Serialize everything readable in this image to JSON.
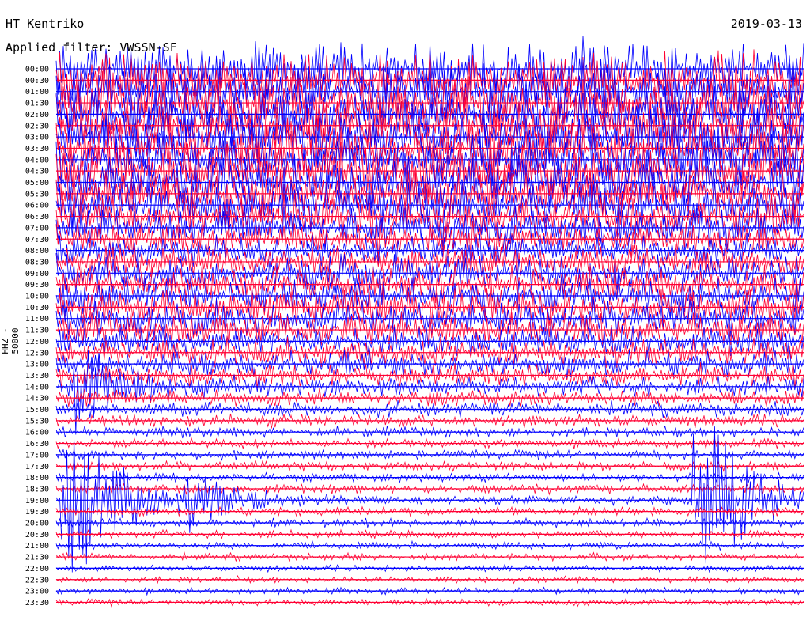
{
  "header": {
    "station": "HT Kentriko",
    "date": "2019-03-13",
    "filter": "Applied filter: VWSSN-SF"
  },
  "chart_data": {
    "type": "line",
    "title": "HT Kentriko",
    "ylabel": "HHZ - 50000",
    "grid": false,
    "colors": {
      "odd_rows": "#0000ff",
      "even_rows": "#ff0033"
    },
    "row_labels": [
      "00:00",
      "00:30",
      "01:00",
      "01:30",
      "02:00",
      "02:30",
      "03:00",
      "03:30",
      "04:00",
      "04:30",
      "05:00",
      "05:30",
      "06:00",
      "06:30",
      "07:00",
      "07:30",
      "08:00",
      "08:30",
      "09:00",
      "09:30",
      "10:00",
      "10:30",
      "11:00",
      "11:30",
      "12:00",
      "12:30",
      "13:00",
      "13:30",
      "14:00",
      "14:30",
      "15:00",
      "15:30",
      "16:00",
      "16:30",
      "17:00",
      "17:30",
      "18:00",
      "18:30",
      "19:00",
      "19:30",
      "20:00",
      "20:30",
      "21:00",
      "21:30",
      "22:00",
      "22:30",
      "23:00",
      "23:30"
    ],
    "relative_amplitude": [
      3.0,
      3.0,
      3.0,
      3.0,
      3.0,
      3.0,
      3.0,
      3.0,
      3.0,
      2.9,
      2.8,
      2.6,
      2.5,
      2.3,
      2.2,
      1.8,
      1.6,
      1.8,
      1.9,
      2.0,
      2.0,
      2.0,
      1.9,
      1.8,
      1.6,
      1.5,
      1.4,
      1.2,
      1.0,
      0.9,
      0.8,
      0.7,
      0.6,
      0.5,
      0.5,
      0.5,
      0.5,
      0.5,
      0.5,
      0.45,
      0.45,
      0.4,
      0.4,
      0.4,
      0.35,
      0.35,
      0.35,
      0.35
    ],
    "events": [
      {
        "row": "19:00",
        "minute": 0.5,
        "magnitude": "large"
      },
      {
        "row": "19:00",
        "minute": 25.8,
        "magnitude": "large"
      },
      {
        "row": "14:00",
        "minute": 1.0,
        "magnitude": "medium"
      },
      {
        "row": "19:00",
        "minute": 5.4,
        "magnitude": "small"
      }
    ]
  }
}
